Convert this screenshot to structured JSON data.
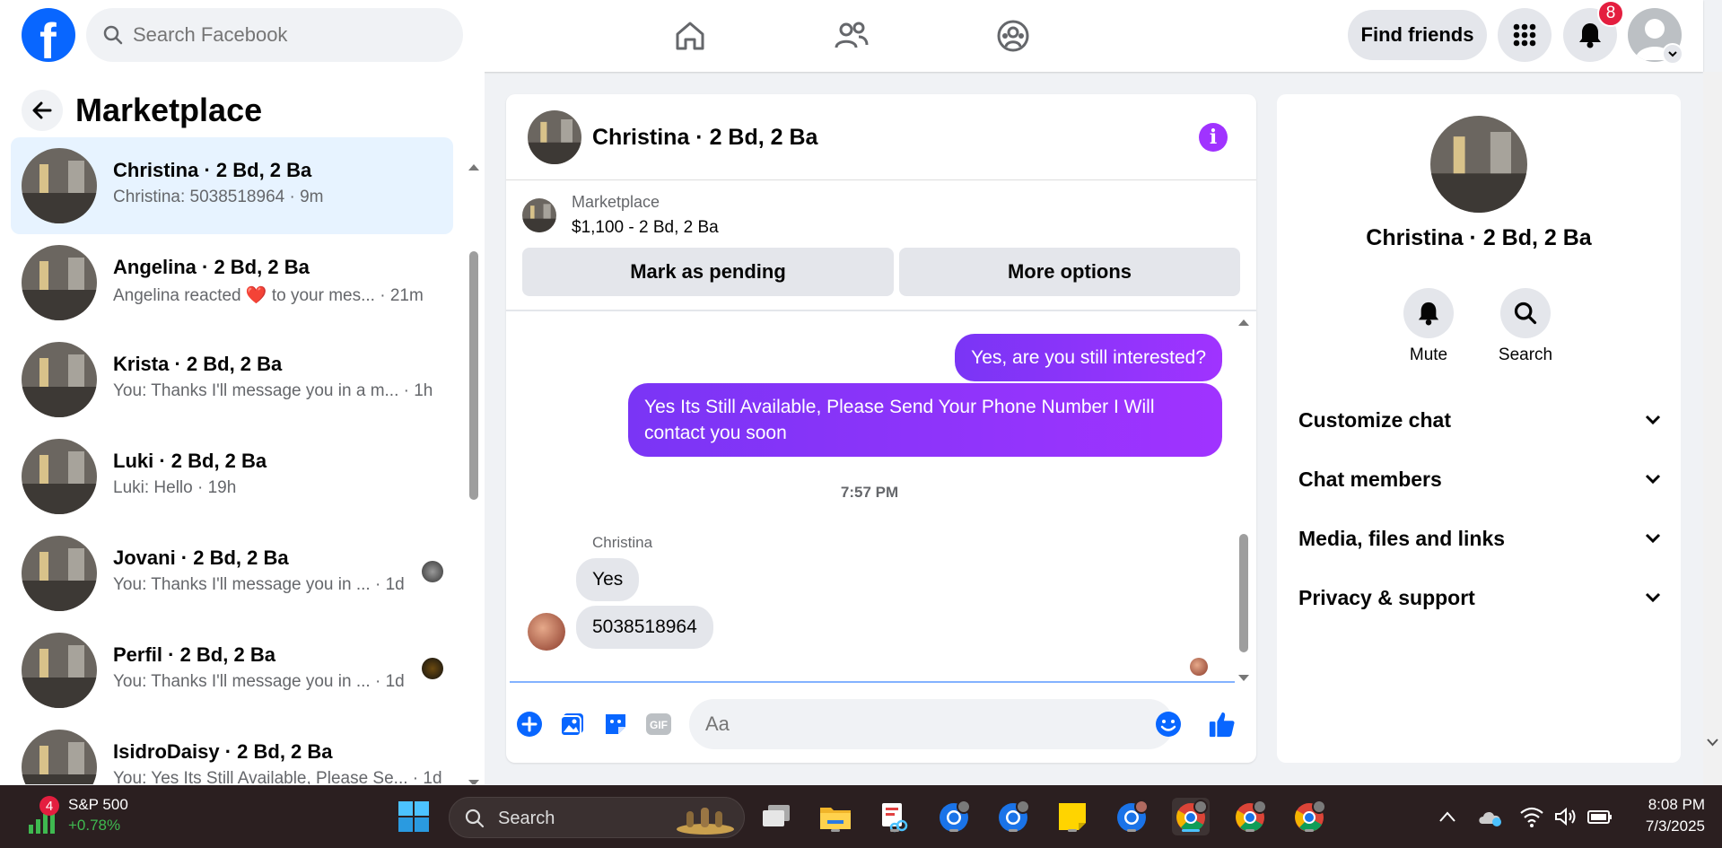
{
  "top": {
    "search_placeholder": "Search Facebook",
    "find_friends": "Find friends",
    "notif_count": "8"
  },
  "left": {
    "title": "Marketplace",
    "conversations": [
      {
        "name": "Christina · 2 Bd, 2 Ba",
        "preview": "Christina: 5038518964 · 9m"
      },
      {
        "name": "Angelina · 2 Bd, 2 Ba",
        "preview_a": "Angelina reacted",
        "preview_emoji": "❤️",
        "preview_b": "to your mes... · 21m"
      },
      {
        "name": "Krista · 2 Bd, 2 Ba",
        "preview": "You: Thanks I'll message you in a m... · 1h"
      },
      {
        "name": "Luki · 2 Bd, 2 Ba",
        "preview": "Luki: Hello · 19h"
      },
      {
        "name": "Jovani · 2 Bd, 2 Ba",
        "preview": "You: Thanks I'll message you in ... · 1d"
      },
      {
        "name": "Perfil · 2 Bd, 2 Ba",
        "preview": "You: Thanks I'll message you in ... · 1d"
      },
      {
        "name": "IsidroDaisy · 2 Bd, 2 Ba",
        "preview": "You: Yes Its Still Available, Please Se... · 1d"
      }
    ]
  },
  "chat": {
    "title": "Christina · 2 Bd, 2 Ba",
    "marketplace_label": "Marketplace",
    "listing": "$1,100 - 2 Bd, 2 Ba",
    "mark_pending": "Mark as pending",
    "more_options": "More options",
    "out_msg_1": "Yes, are you still interested?",
    "out_msg_2": "Yes Its Still Available, Please Send Your Phone Number I Will contact you soon",
    "time": "7:57 PM",
    "sender": "Christina",
    "in_msg_1": "Yes",
    "in_msg_2": "5038518964",
    "input_placeholder": "Aa"
  },
  "right": {
    "name": "Christina · 2 Bd, 2 Ba",
    "mute": "Mute",
    "search": "Search",
    "sections": [
      "Customize chat",
      "Chat members",
      "Media, files and links",
      "Privacy & support"
    ]
  },
  "taskbar": {
    "stock_name": "S&P 500",
    "stock_change": "+0.78%",
    "stock_badge": "4",
    "search_label": "Search",
    "time": "8:08 PM",
    "date": "7/3/2025"
  },
  "colors": {
    "brand": "#0866ff",
    "accent": "#a033ff",
    "badge": "#e41e3f"
  }
}
